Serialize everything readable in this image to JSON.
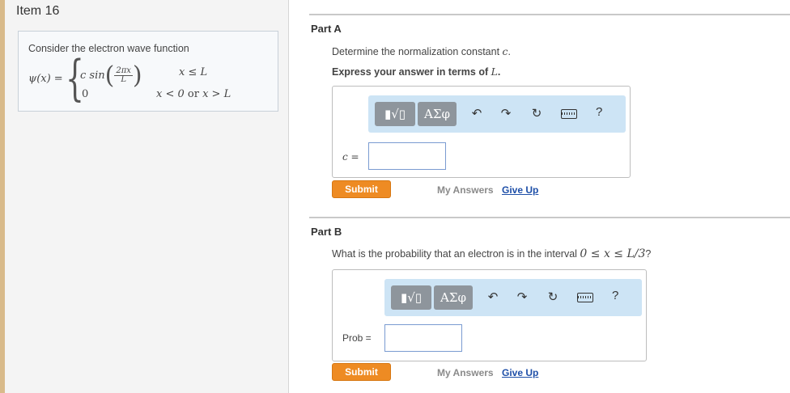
{
  "item": {
    "title": "Item 16"
  },
  "problem": {
    "intro": "Consider the electron wave function",
    "lhs": "ψ(x) =",
    "case1_coef": "c sin",
    "case1_frac_num": "2πx",
    "case1_frac_den": "L",
    "case1_condition": "x ≤ L",
    "case2_value": "0",
    "case2_cond_a": "x < 0",
    "case2_cond_or": " or ",
    "case2_cond_b": "x > L"
  },
  "partA": {
    "title": "Part A",
    "question": "Determine the normalization constant ",
    "question_var": "c",
    "question_end": ".",
    "instruction": "Express your answer in terms of ",
    "instruction_var": "L",
    "instruction_end": ".",
    "answer_label": "c =",
    "submit": "Submit",
    "my_answers": "My Answers",
    "give_up": "Give Up"
  },
  "partB": {
    "title": "Part B",
    "question": "What is the probability that an electron is in the interval ",
    "question_math": "0 ≤ x ≤ L/3",
    "question_end": "?",
    "answer_label": "Prob =",
    "submit": "Submit",
    "my_answers": "My Answers",
    "give_up": "Give Up"
  },
  "toolbar": {
    "template_label": "▮√▯",
    "greek_label": "ΑΣφ",
    "undo": "↶",
    "redo": "↷",
    "reset": "↻",
    "help": "?",
    "icons": [
      "templates-icon",
      "greek-symbols-icon",
      "undo-icon",
      "redo-icon",
      "reset-icon",
      "keyboard-icon",
      "help-icon"
    ]
  },
  "colors": {
    "submit": "#ee8b23",
    "link": "#1e4fa8",
    "toolbar_bg": "#cde4f5",
    "toolbar_btn": "#8e959c"
  }
}
